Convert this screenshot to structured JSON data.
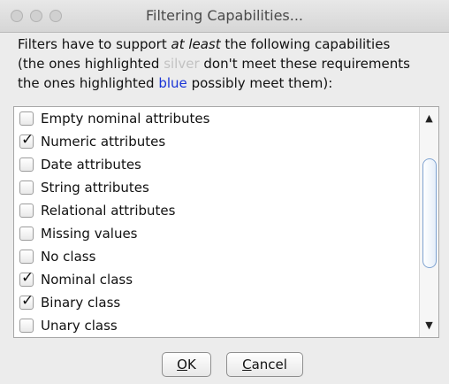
{
  "window": {
    "title": "Filtering Capabilities..."
  },
  "description": {
    "line1_pre": "Filters have to support ",
    "line1_em": "at least",
    "line1_post": " the following capabilities",
    "line2_pre": "(the ones highlighted ",
    "line2_silver": "silver",
    "line2_post": " don't meet these requirements",
    "line3_pre": "the ones highlighted ",
    "line3_blue": "blue",
    "line3_post": " possibly meet them):",
    "silver_color": "#c2c2c2",
    "blue_color": "#1833d6"
  },
  "capabilities": [
    {
      "label": "Empty nominal attributes",
      "checked": false
    },
    {
      "label": "Numeric attributes",
      "checked": true
    },
    {
      "label": "Date attributes",
      "checked": false
    },
    {
      "label": "String attributes",
      "checked": false
    },
    {
      "label": "Relational attributes",
      "checked": false
    },
    {
      "label": "Missing values",
      "checked": false
    },
    {
      "label": "No class",
      "checked": false
    },
    {
      "label": "Nominal class",
      "checked": true
    },
    {
      "label": "Binary class",
      "checked": true
    },
    {
      "label": "Unary class",
      "checked": false
    }
  ],
  "icons": {
    "check": "✓",
    "scroll_up": "▲",
    "scroll_down": "▼"
  },
  "buttons": {
    "ok_mnemonic": "O",
    "ok_rest": "K",
    "cancel_mnemonic": "C",
    "cancel_rest": "ancel"
  }
}
